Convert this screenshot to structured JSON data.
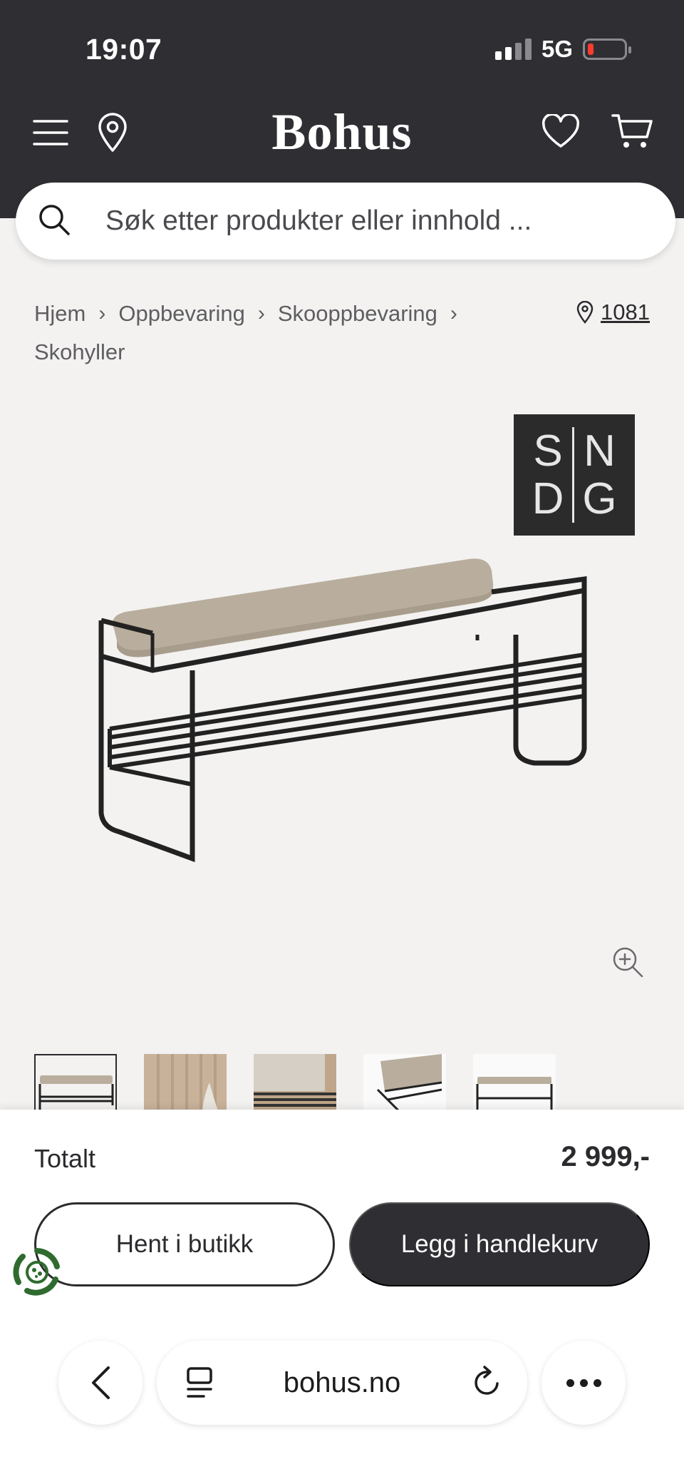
{
  "status_bar": {
    "time": "19:07",
    "network": "5G"
  },
  "header": {
    "logo": "Bohus"
  },
  "search": {
    "placeholder": "Søk etter produkter eller innhold ..."
  },
  "breadcrumb": {
    "items": [
      "Hjem",
      "Oppbevaring",
      "Skooppbevaring",
      "Skohyller"
    ],
    "store_code": "1081"
  },
  "product": {
    "brand_letters": [
      "S",
      "N",
      "D",
      "G"
    ],
    "thumbnail_count": 5
  },
  "checkout": {
    "total_label": "Totalt",
    "total_price": "2 999,-",
    "pickup_label": "Hent i butikk",
    "add_to_cart_label": "Legg i handlekurv"
  },
  "browser": {
    "url": "bohus.no"
  },
  "colors": {
    "header_bg": "#2f2f33",
    "dark_button": "#2f2f33",
    "eco_green": "#2f6b2f",
    "battery_low": "#ff3b30"
  }
}
